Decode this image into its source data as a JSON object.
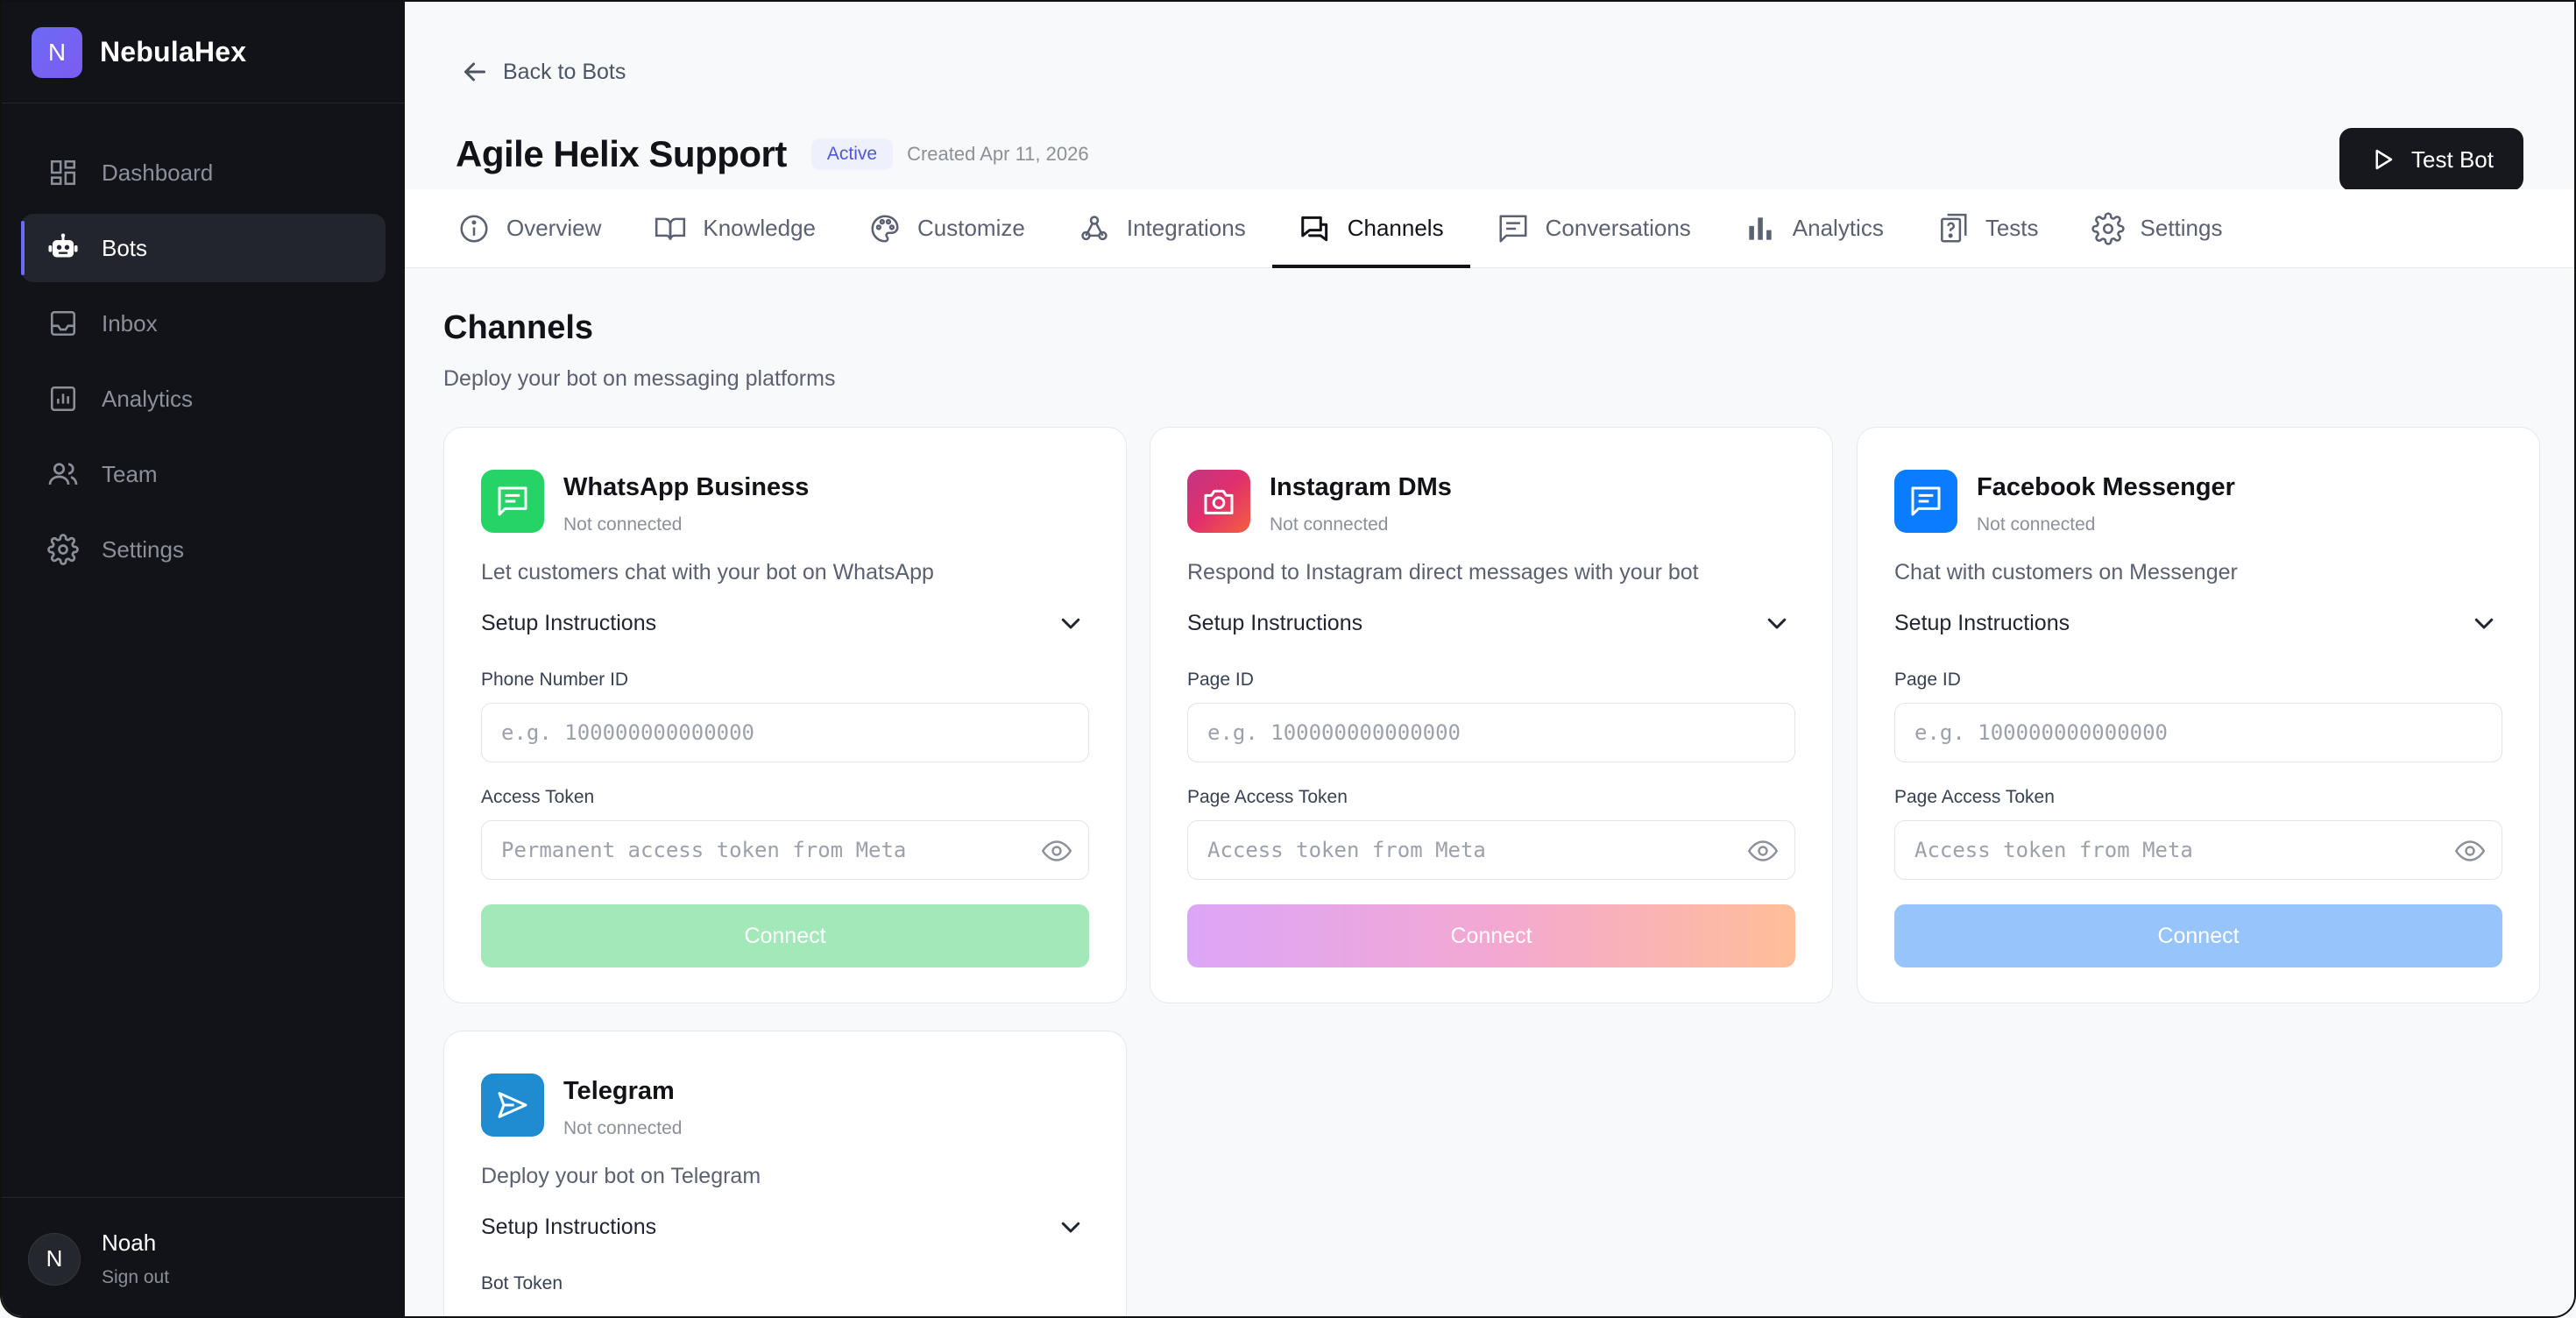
{
  "brand": {
    "logo_letter": "N",
    "name": "NebulaHex"
  },
  "sidebar": {
    "items": [
      {
        "label": "Dashboard",
        "icon": "dashboard-icon"
      },
      {
        "label": "Bots",
        "icon": "robot-icon"
      },
      {
        "label": "Inbox",
        "icon": "inbox-icon"
      },
      {
        "label": "Analytics",
        "icon": "chart-icon"
      },
      {
        "label": "Team",
        "icon": "team-icon"
      },
      {
        "label": "Settings",
        "icon": "gear-icon"
      }
    ],
    "active": "Bots"
  },
  "user": {
    "initial": "N",
    "name": "Noah",
    "signout": "Sign out"
  },
  "header": {
    "back_label": "Back to Bots",
    "title": "Agile Helix Support",
    "status": "Active",
    "created": "Created Apr 11, 2026",
    "test_button": "Test Bot"
  },
  "tabs": [
    {
      "label": "Overview",
      "icon": "info-icon"
    },
    {
      "label": "Knowledge",
      "icon": "book-icon"
    },
    {
      "label": "Customize",
      "icon": "palette-icon"
    },
    {
      "label": "Integrations",
      "icon": "webhook-icon"
    },
    {
      "label": "Channels",
      "icon": "chat-bubbles-icon"
    },
    {
      "label": "Conversations",
      "icon": "message-icon"
    },
    {
      "label": "Analytics",
      "icon": "bar-chart-icon"
    },
    {
      "label": "Tests",
      "icon": "test-icon"
    },
    {
      "label": "Settings",
      "icon": "gear-icon"
    }
  ],
  "active_tab": "Channels",
  "page": {
    "title": "Channels",
    "subtitle": "Deploy your bot on messaging platforms"
  },
  "channels": [
    {
      "name": "WhatsApp Business",
      "status": "Not connected",
      "description": "Let customers chat with your bot on WhatsApp",
      "setup_label": "Setup Instructions",
      "field1_label": "Phone Number ID",
      "field1_placeholder": "e.g. 100000000000000",
      "field2_label": "Access Token",
      "field2_placeholder": "Permanent access token from Meta",
      "button": "Connect",
      "color": "#25d366",
      "button_color": "#a3e8b8"
    },
    {
      "name": "Instagram DMs",
      "status": "Not connected",
      "description": "Respond to Instagram direct messages with your bot",
      "setup_label": "Setup Instructions",
      "field1_label": "Page ID",
      "field1_placeholder": "e.g. 100000000000000",
      "field2_label": "Page Access Token",
      "field2_placeholder": "Access token from Meta",
      "button": "Connect",
      "color": "#e1306c",
      "button_color": "#f4a8d0"
    },
    {
      "name": "Facebook Messenger",
      "status": "Not connected",
      "description": "Chat with customers on Messenger",
      "setup_label": "Setup Instructions",
      "field1_label": "Page ID",
      "field1_placeholder": "e.g. 100000000000000",
      "field2_label": "Page Access Token",
      "field2_placeholder": "Access token from Meta",
      "button": "Connect",
      "color": "#0a7cff",
      "button_color": "#96c4fb"
    },
    {
      "name": "Telegram",
      "status": "Not connected",
      "description": "Deploy your bot on Telegram",
      "setup_label": "Setup Instructions",
      "field1_label": "Bot Token",
      "color": "#1f8bd0"
    }
  ]
}
